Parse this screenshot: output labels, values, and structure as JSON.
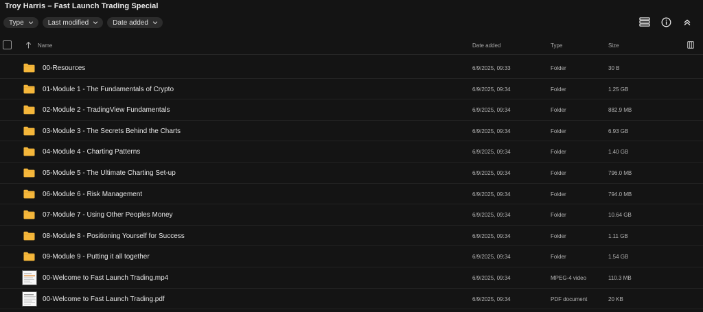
{
  "page": {
    "title": "Troy Harris – Fast Launch Trading Special"
  },
  "filters": [
    {
      "label": "Type",
      "icon": "chevron-down-icon"
    },
    {
      "label": "Last modified",
      "icon": "chevron-down-icon"
    },
    {
      "label": "Date added",
      "icon": "chevron-down-icon"
    }
  ],
  "toolbar": {
    "icons": [
      "list-view-icon",
      "info-icon",
      "collapse-icon"
    ]
  },
  "table": {
    "headers": {
      "name": "Name",
      "date": "Date added",
      "type": "Type",
      "size": "Size"
    },
    "sort_icon": "arrow-up-icon",
    "columns_icon": "columns-icon",
    "rows": [
      {
        "name": "00-Resources",
        "date": "6/9/2025, 09:33",
        "type": "Folder",
        "size": "30 B",
        "icon": "folder-icon"
      },
      {
        "name": "01-Module 1 - The Fundamentals of Crypto",
        "date": "6/9/2025, 09:34",
        "type": "Folder",
        "size": "1.25 GB",
        "icon": "folder-icon"
      },
      {
        "name": "02-Module 2 - TradingView Fundamentals",
        "date": "6/9/2025, 09:34",
        "type": "Folder",
        "size": "882.9 MB",
        "icon": "folder-icon"
      },
      {
        "name": "03-Module 3 - The Secrets Behind the Charts",
        "date": "6/9/2025, 09:34",
        "type": "Folder",
        "size": "6.93 GB",
        "icon": "folder-icon"
      },
      {
        "name": "04-Module 4 - Charting Patterns",
        "date": "6/9/2025, 09:34",
        "type": "Folder",
        "size": "1.40 GB",
        "icon": "folder-icon"
      },
      {
        "name": "05-Module 5 - The Ultimate Charting Set-up",
        "date": "6/9/2025, 09:34",
        "type": "Folder",
        "size": "796.0 MB",
        "icon": "folder-icon"
      },
      {
        "name": "06-Module 6 - Risk Management",
        "date": "6/9/2025, 09:34",
        "type": "Folder",
        "size": "794.0 MB",
        "icon": "folder-icon"
      },
      {
        "name": "07-Module 7 - Using Other Peoples Money",
        "date": "6/9/2025, 09:34",
        "type": "Folder",
        "size": "10.64 GB",
        "icon": "folder-icon"
      },
      {
        "name": "08-Module 8 - Positioning Yourself for Success",
        "date": "6/9/2025, 09:34",
        "type": "Folder",
        "size": "1.11 GB",
        "icon": "folder-icon"
      },
      {
        "name": "09-Module 9 - Putting it all together",
        "date": "6/9/2025, 09:34",
        "type": "Folder",
        "size": "1.54 GB",
        "icon": "folder-icon"
      },
      {
        "name": "00-Welcome to Fast Launch Trading.mp4",
        "date": "6/9/2025, 09:34",
        "type": "MPEG-4 video",
        "size": "110.3 MB",
        "icon": "video-thumbnail-icon"
      },
      {
        "name": "00-Welcome to Fast Launch Trading.pdf",
        "date": "6/9/2025, 09:34",
        "type": "PDF document",
        "size": "20 KB",
        "icon": "pdf-thumbnail-icon"
      }
    ]
  },
  "colors": {
    "background": "#141414",
    "folder": "#f5b73b",
    "chip": "#2c2c2c"
  }
}
